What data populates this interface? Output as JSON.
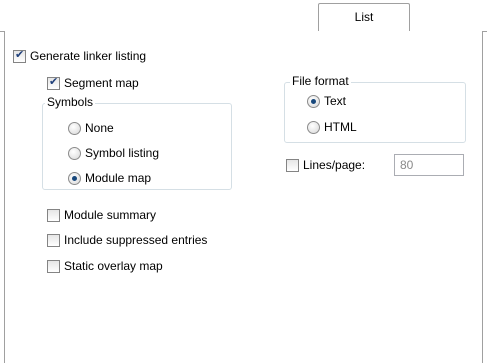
{
  "tabs": [
    {
      "label": "List",
      "active": true
    }
  ],
  "main": {
    "generate_linker_listing": {
      "label": "Generate linker listing",
      "checked": true
    },
    "segment_map": {
      "label": "Segment map",
      "checked": true
    },
    "symbols": {
      "title": "Symbols",
      "options": [
        {
          "label": "None",
          "selected": false
        },
        {
          "label": "Symbol listing",
          "selected": false
        },
        {
          "label": "Module map",
          "selected": true
        }
      ]
    },
    "module_summary": {
      "label": "Module summary",
      "checked": false
    },
    "include_suppressed_entries": {
      "label": "Include suppressed entries",
      "checked": false
    },
    "static_overlay_map": {
      "label": "Static overlay map",
      "checked": false
    },
    "file_format": {
      "title": "File format",
      "options": [
        {
          "label": "Text",
          "selected": true
        },
        {
          "label": "HTML",
          "selected": false
        }
      ]
    },
    "lines_per_page": {
      "label": "Lines/page:",
      "checked": false,
      "value": "80"
    }
  },
  "colors": {
    "border": "#a0a0a0",
    "group_border": "#d5dfe5",
    "radio_dot": "#18487c",
    "check_mark": "#1f3f7a",
    "disabled_text": "#8a8a8a"
  }
}
